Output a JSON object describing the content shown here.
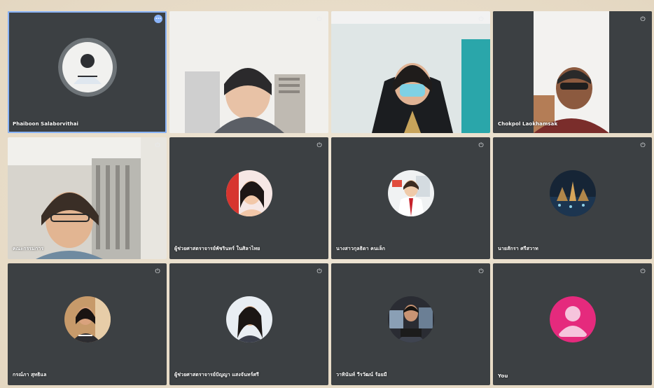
{
  "tiles": [
    {
      "name": "Phaiboon Salaborvithai",
      "mic_icon": "more-icon"
    },
    {
      "name": "",
      "mic_icon": "mic-off-icon"
    },
    {
      "name": "",
      "mic_icon": "mic-off-icon"
    },
    {
      "name": "Chokpol Laokhamsak",
      "mic_icon": "mic-off-icon"
    },
    {
      "name": "คณะกรรมการ",
      "mic_icon": "mic-off-icon"
    },
    {
      "name": "ผู้ช่วยศาสตราจารย์พัชรินทร์ ในศิลาไทย",
      "mic_icon": "mic-off-icon"
    },
    {
      "name": "นางสาวกุลธิดา คนเล็ก",
      "mic_icon": "mic-off-icon"
    },
    {
      "name": "นายสักรา ศรีสวาท",
      "mic_icon": "mic-off-icon"
    },
    {
      "name": "กรณ์ภา สุทธิแล",
      "mic_icon": "mic-off-icon"
    },
    {
      "name": "ผู้ช่วยศาสตราจารย์ปัญญา แสงจันทร์ศรี",
      "mic_icon": "mic-off-icon"
    },
    {
      "name": "วาทินันท์ วีรวัฒน์ ร้อยมี",
      "mic_icon": "mic-off-icon"
    },
    {
      "name": "You",
      "mic_icon": "mic-off-icon"
    }
  ]
}
